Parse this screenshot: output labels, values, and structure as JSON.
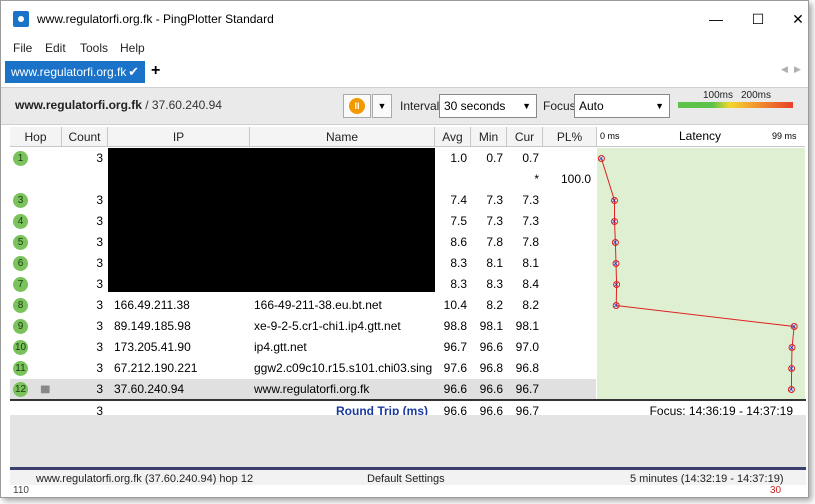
{
  "window": {
    "title": "www.regulatorfi.org.fk - PingPlotter Standard",
    "minimize_glyph": "—",
    "maximize_glyph": "☐",
    "close_glyph": "✕"
  },
  "menu": [
    "File",
    "Edit",
    "Tools",
    "Help"
  ],
  "tabs": [
    {
      "label": "www.regulatorfi.org.fk",
      "status_glyph": "✔"
    }
  ],
  "tab_add_glyph": "+",
  "tab_nav": {
    "left": "◀",
    "right": "▶"
  },
  "toolbar": {
    "target_host": "www.regulatorfi.org.fk",
    "target_ip": "/ 37.60.240.94",
    "pause_glyph": "II",
    "dropdown_glyph": "▼",
    "interval_label": "Interval",
    "interval_value": "30 seconds",
    "focus_label": "Focus",
    "focus_value": "Auto",
    "legend_100": "100ms",
    "legend_200": "200ms",
    "colors": {
      "good": "#5cc24a",
      "warn": "#f2d72c",
      "bad": "#e8402c"
    }
  },
  "columns": {
    "hop": "Hop",
    "count": "Count",
    "ip": "IP",
    "name": "Name",
    "avg": "Avg",
    "min": "Min",
    "cur": "Cur",
    "pl": "PL%",
    "lat_min": "0 ms",
    "latency": "Latency",
    "lat_max": "99 ms"
  },
  "rows": [
    {
      "hop": "1",
      "count": "3",
      "ip": "",
      "name": "",
      "avg": "1.0",
      "min": "0.7",
      "cur": "0.7",
      "pl": "",
      "latency": 0.7
    },
    {
      "hop": "",
      "count": "",
      "ip": "",
      "name": "",
      "avg": "",
      "min": "",
      "cur": "*",
      "pl": "100.0",
      "latency": null
    },
    {
      "hop": "3",
      "count": "3",
      "ip": "",
      "name": "",
      "avg": "7.4",
      "min": "7.3",
      "cur": "7.3",
      "pl": "",
      "latency": 7.3
    },
    {
      "hop": "4",
      "count": "3",
      "ip": "",
      "name": "",
      "avg": "7.5",
      "min": "7.3",
      "cur": "7.3",
      "pl": "",
      "latency": 7.3
    },
    {
      "hop": "5",
      "count": "3",
      "ip": "",
      "name": "",
      "avg": "8.6",
      "min": "7.8",
      "cur": "7.8",
      "pl": "",
      "latency": 7.8
    },
    {
      "hop": "6",
      "count": "3",
      "ip": "",
      "name": "",
      "avg": "8.3",
      "min": "8.1",
      "cur": "8.1",
      "pl": "",
      "latency": 8.1
    },
    {
      "hop": "7",
      "count": "3",
      "ip": "",
      "name": "",
      "avg": "8.3",
      "min": "8.3",
      "cur": "8.4",
      "pl": "",
      "latency": 8.4
    },
    {
      "hop": "8",
      "count": "3",
      "ip": "166.49.211.38",
      "name": "166-49-211-38.eu.bt.net",
      "avg": "10.4",
      "min": "8.2",
      "cur": "8.2",
      "pl": "",
      "latency": 8.2
    },
    {
      "hop": "9",
      "count": "3",
      "ip": "89.149.185.98",
      "name": "xe-9-2-5.cr1-chi1.ip4.gtt.net",
      "avg": "98.8",
      "min": "98.1",
      "cur": "98.1",
      "pl": "",
      "latency": 98.1
    },
    {
      "hop": "10",
      "count": "3",
      "ip": "173.205.41.90",
      "name": "ip4.gtt.net",
      "avg": "96.7",
      "min": "96.6",
      "cur": "97.0",
      "pl": "",
      "latency": 97.0
    },
    {
      "hop": "11",
      "count": "3",
      "ip": "67.212.190.221",
      "name": "ggw2.c09c10.r15.s101.chi03.singl",
      "avg": "97.6",
      "min": "96.8",
      "cur": "96.8",
      "pl": "",
      "latency": 96.8
    },
    {
      "hop": "12",
      "count": "3",
      "ip": "37.60.240.94",
      "name": "www.regulatorfi.org.fk",
      "avg": "96.6",
      "min": "96.6",
      "cur": "96.7",
      "pl": "",
      "latency": 96.7
    }
  ],
  "round_trip": {
    "count": "3",
    "label": "Round Trip (ms)",
    "avg": "96.6",
    "min": "96.6",
    "cur": "96.7",
    "focus": "Focus: 14:36:19 - 14:37:19"
  },
  "status": {
    "left": "www.regulatorfi.org.fk (37.60.240.94) hop 12",
    "center": "Default Settings",
    "right": "5 minutes (14:32:19 - 14:37:19)",
    "bottom_left": "110",
    "bottom_right": "30"
  },
  "latency_max": 99
}
